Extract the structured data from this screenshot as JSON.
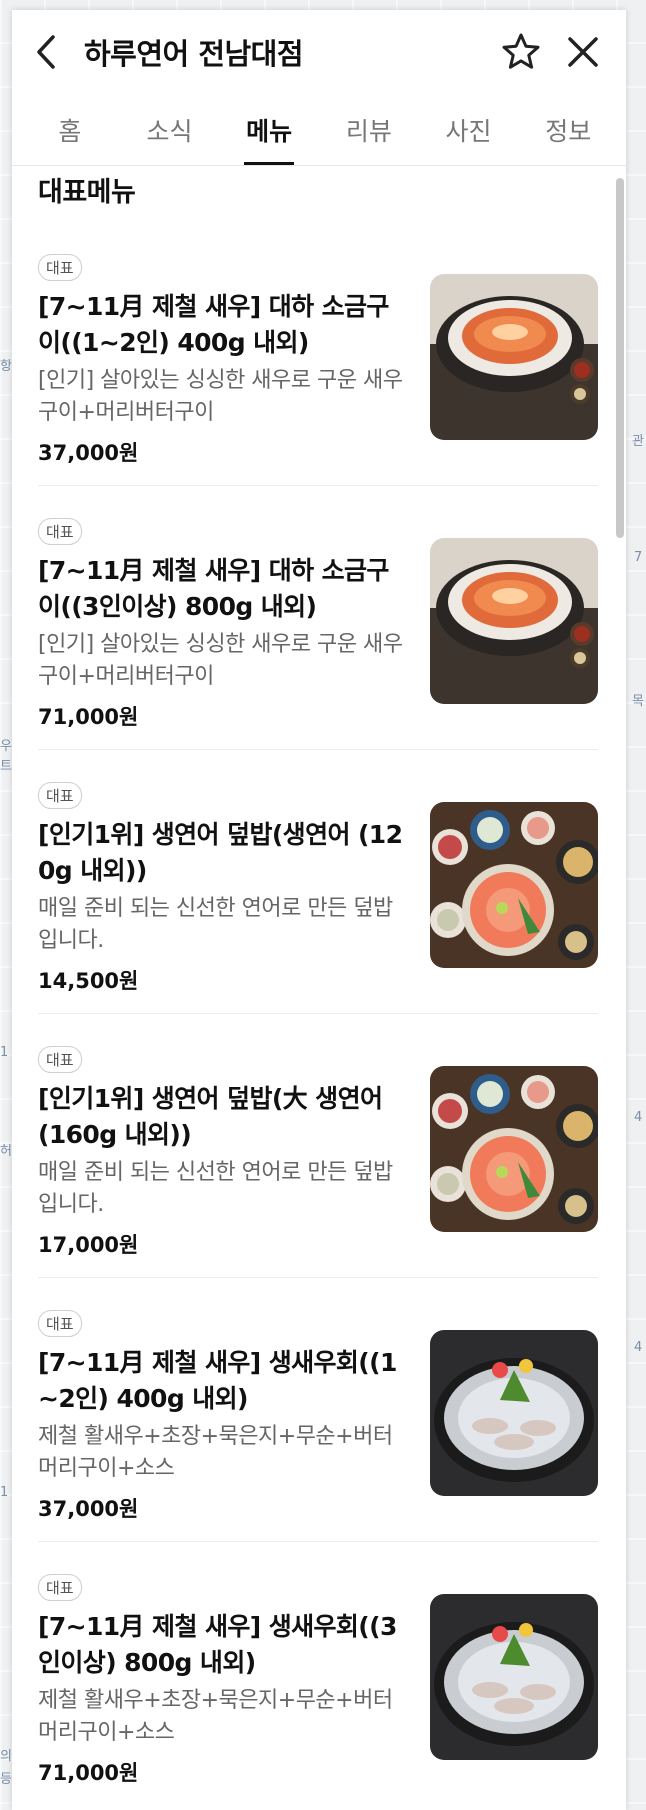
{
  "header": {
    "title": "하루연어 전남대점"
  },
  "tabs": [
    {
      "label": "홈",
      "active": false
    },
    {
      "label": "소식",
      "active": false
    },
    {
      "label": "메뉴",
      "active": true
    },
    {
      "label": "리뷰",
      "active": false
    },
    {
      "label": "사진",
      "active": false
    },
    {
      "label": "정보",
      "active": false
    }
  ],
  "section": {
    "title": "대표메뉴"
  },
  "menu_items": [
    {
      "badge": "대표",
      "name": "[7~11月 제철 새우] 대하 소금구이((1~2인) 400g 내외)",
      "desc": "[인기] 살아있는 싱싱한 새우로 구운 새우구이+머리버터구이",
      "price": "37,000원",
      "image": "shrimp-salt-grill"
    },
    {
      "badge": "대표",
      "name": "[7~11月 제철 새우] 대하 소금구이((3인이상) 800g 내외)",
      "desc": "[인기] 살아있는 싱싱한 새우로 구운 새우구이+머리버터구이",
      "price": "71,000원",
      "image": "shrimp-salt-grill"
    },
    {
      "badge": "대표",
      "name": "[인기1위] 생연어 덮밥(생연어 (120g 내외))",
      "desc": "매일 준비 되는 신선한 연어로 만든 덮밥입니다.",
      "price": "14,500원",
      "image": "salmon-rice-bowl"
    },
    {
      "badge": "대표",
      "name": "[인기1위] 생연어 덮밥(大 생연어 (160g 내외))",
      "desc": "매일 준비 되는 신선한 연어로 만든 덮밥입니다.",
      "price": "17,000원",
      "image": "salmon-rice-bowl"
    },
    {
      "badge": "대표",
      "name": "[7~11月 제철 새우] 생새우회((1~2인) 400g 내외)",
      "desc": "제철 활새우+초장+묵은지+무순+버터머리구이+소스",
      "price": "37,000원",
      "image": "raw-shrimp-sashimi"
    },
    {
      "badge": "대표",
      "name": "[7~11月 제철 새우] 생새우회((3인이상) 800g 내외)",
      "desc": "제철 활새우+초장+묵은지+무순+버터머리구이+소스",
      "price": "71,000원",
      "image": "raw-shrimp-sashimi"
    }
  ],
  "map_labels": [
    "항",
    "관",
    "7",
    "목",
    "우",
    "트",
    "1",
    "4",
    "허",
    "4",
    "1",
    "의",
    "등"
  ]
}
